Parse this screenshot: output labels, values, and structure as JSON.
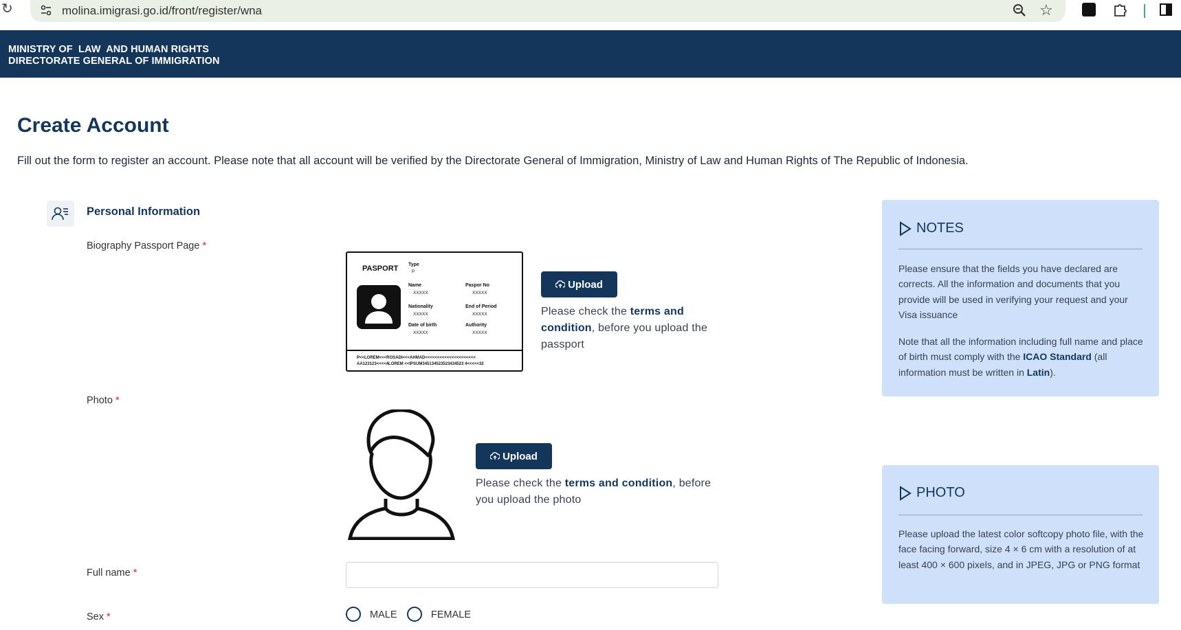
{
  "browser": {
    "url": "molina.imigrasi.go.id/front/register/wna",
    "icons": [
      "reload-icon",
      "site-info-icon",
      "zoom-icon",
      "star-icon",
      "extension-icon",
      "puzzle-icon",
      "side-panel-icon"
    ]
  },
  "header": {
    "line1": "MINISTRY OF  LAW  AND HUMAN RIGHTS",
    "line2": "DIRECTORATE GENERAL OF IMMIGRATION"
  },
  "page": {
    "title": "Create Account",
    "intro": "Fill out the form to register an account. Please note that all account will be verified by the Directorate General of Immigration, Ministry of Law and Human Rights of The Republic of Indonesia."
  },
  "section": {
    "title": "Personal Information"
  },
  "form": {
    "passport_label": "Biography Passport Page",
    "photo_label": "Photo",
    "fullname_label": "Full name",
    "fullname_value": "",
    "sex_label": "Sex",
    "required_mark": "*",
    "upload_label": "Upload",
    "passport_hint": {
      "pre": "Please check the ",
      "bold": "terms and condition",
      "post": ", before you upload the passport"
    },
    "photo_hint": {
      "pre": "Please check the ",
      "bold": "terms and condition",
      "post": ", before you upload the photo"
    },
    "sex_options": [
      "MALE",
      "FEMALE"
    ]
  },
  "passport_sample": {
    "heading": "PASPORT",
    "type_label": "Type",
    "type_value": "P",
    "name_label": "Name",
    "nationality_label": "Nationality",
    "dob_label": "Date of birth",
    "passport_no_label": "Paspor No",
    "end_label": "End of Period",
    "authority_label": "Authority",
    "placeholder": "XXXXX",
    "mrz1": "P<<LOREM<<<ROSADI<<<AHMAD<<<<<<<<<<<<<<<<<<<<<",
    "mrz2": "AA123123<<<<4LOREM <<IPSUM345134523523434523 4<<<<<32"
  },
  "notes": {
    "title": "NOTES",
    "p1": "Please ensure that the fields you have declared are corrects. All the information and documents that you provide will be used in verifying your request and your Visa issuance",
    "p2_pre": "Note that all the information including full name and place of birth must comply with the ",
    "p2_bold1": "ICAO Standard",
    "p2_mid": " (all information must be written in ",
    "p2_bold2": "Latin",
    "p2_post": ")."
  },
  "photo_note": {
    "title": "PHOTO",
    "text": "Please upload the latest color softcopy photo file, with the face facing forward, size 4 × 6 cm with a resolution of at least 400 × 600 pixels, and in JPEG, JPG or PNG format"
  },
  "colors": {
    "brand": "#14365b",
    "note_bg": "#cfe0fa",
    "required": "#dc2626"
  }
}
